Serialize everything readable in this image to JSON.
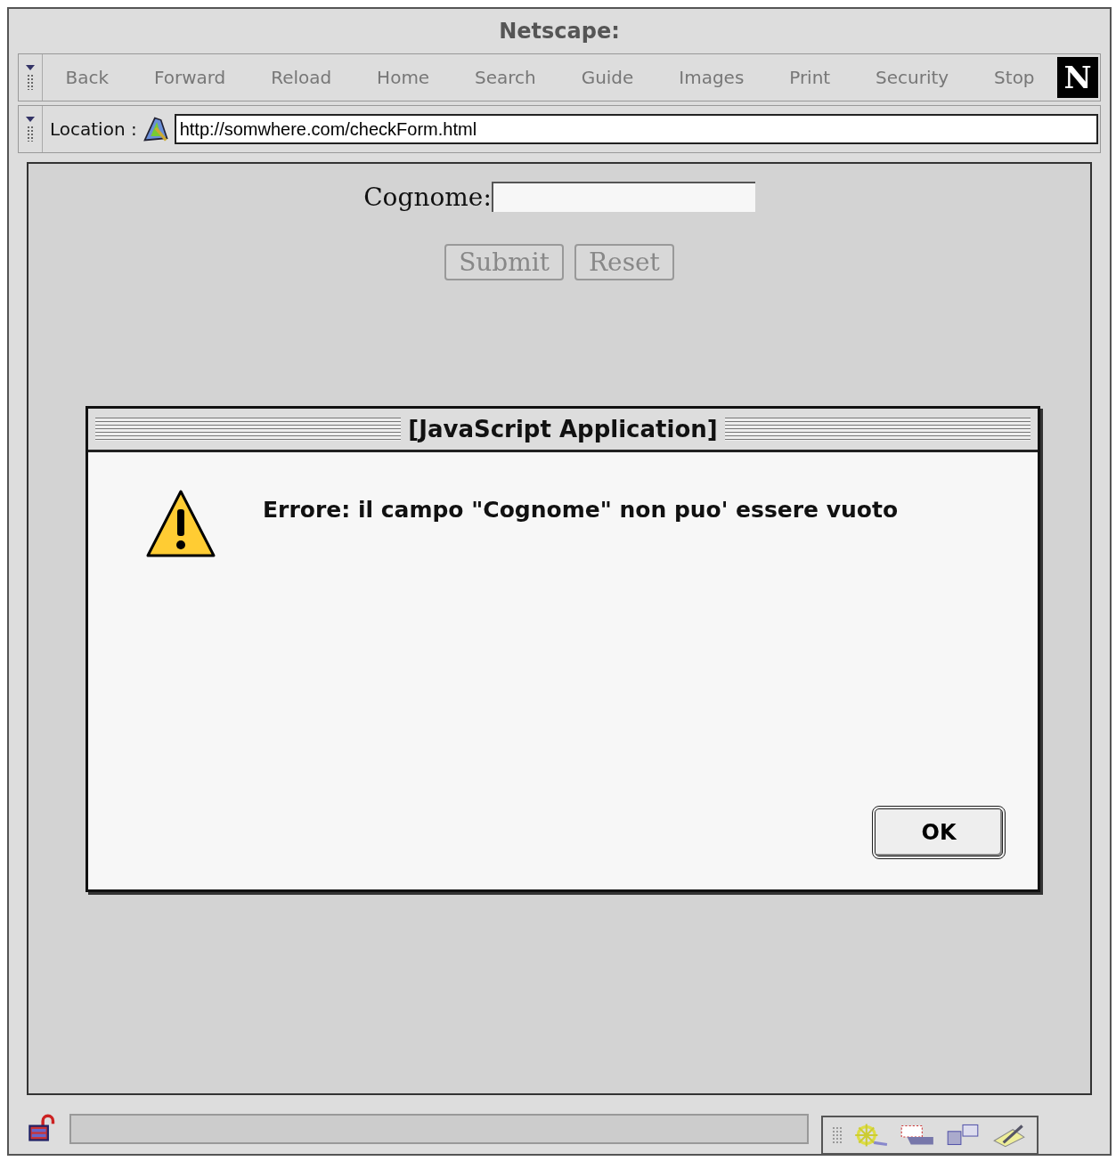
{
  "window": {
    "title": "Netscape:"
  },
  "toolbar": {
    "buttons": [
      {
        "label": "Back",
        "disabled": true
      },
      {
        "label": "Forward",
        "disabled": true
      },
      {
        "label": "Reload",
        "disabled": true
      },
      {
        "label": "Home",
        "disabled": true
      },
      {
        "label": "Search",
        "disabled": true
      },
      {
        "label": "Guide",
        "disabled": true
      },
      {
        "label": "Images",
        "disabled": true
      },
      {
        "label": "Print",
        "disabled": true
      },
      {
        "label": "Security",
        "disabled": true
      },
      {
        "label": "Stop",
        "disabled": true
      }
    ],
    "logo": "N"
  },
  "location": {
    "label": "Location :",
    "value": "http://somwhere.com/checkForm.html"
  },
  "form": {
    "label": "Cognome:",
    "buttons": [
      {
        "label": "Submit",
        "disabled": true
      },
      {
        "label": "Reset",
        "disabled": true
      }
    ]
  },
  "dialog": {
    "title": "[JavaScript Application]",
    "message": "Errore: il campo \"Cognome\" non puo' essere vuoto",
    "button": "OK"
  }
}
